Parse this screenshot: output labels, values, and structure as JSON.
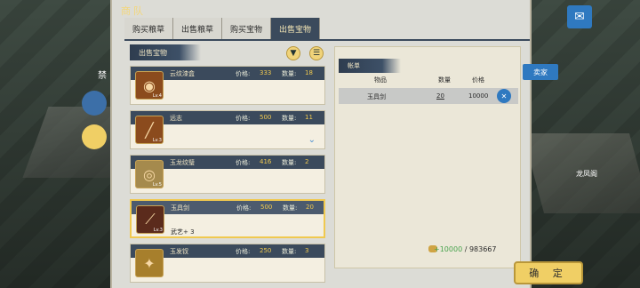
{
  "window": {
    "title": "商队"
  },
  "tabs": [
    {
      "label": "购买粮草"
    },
    {
      "label": "出售粮草"
    },
    {
      "label": "购买宝物"
    },
    {
      "label": "出售宝物",
      "active": true
    }
  ],
  "left_panel": {
    "header": "出售宝物",
    "items": [
      {
        "name": "云纹漆盒",
        "price_label": "价格:",
        "price": "333",
        "qty_label": "数量:",
        "qty": "18",
        "level": "Lv.4",
        "icon": "lacquer-box-icon"
      },
      {
        "name": "远志",
        "price_label": "价格:",
        "price": "500",
        "qty_label": "数量:",
        "qty": "11",
        "level": "Lv.3",
        "icon": "herb-icon"
      },
      {
        "name": "玉龙纹璧",
        "price_label": "价格:",
        "price": "416",
        "qty_label": "数量:",
        "qty": "2",
        "level": "Lv.5",
        "icon": "jade-disc-icon"
      },
      {
        "name": "玉具剑",
        "price_label": "价格:",
        "price": "500",
        "qty_label": "数量:",
        "qty": "20",
        "level": "Lv.3",
        "extra": "武艺+ 3",
        "icon": "sword-icon",
        "selected": true
      },
      {
        "name": "玉发钗",
        "price_label": "价格:",
        "price": "250",
        "qty_label": "数量:",
        "qty": "3",
        "level": "",
        "icon": "hairpin-icon"
      }
    ]
  },
  "right_panel": {
    "header": "帐单",
    "columns": [
      "物品",
      "数量",
      "价格"
    ],
    "row": {
      "item": "玉具剑",
      "qty": "20",
      "price": "10000"
    },
    "total": {
      "gained": "+10000",
      "current": "/ 983667"
    }
  },
  "buttons": {
    "confirm": "确 定",
    "customer": "卖家"
  },
  "side": {
    "left_label": "禁",
    "right_label": "龙凤阁"
  }
}
